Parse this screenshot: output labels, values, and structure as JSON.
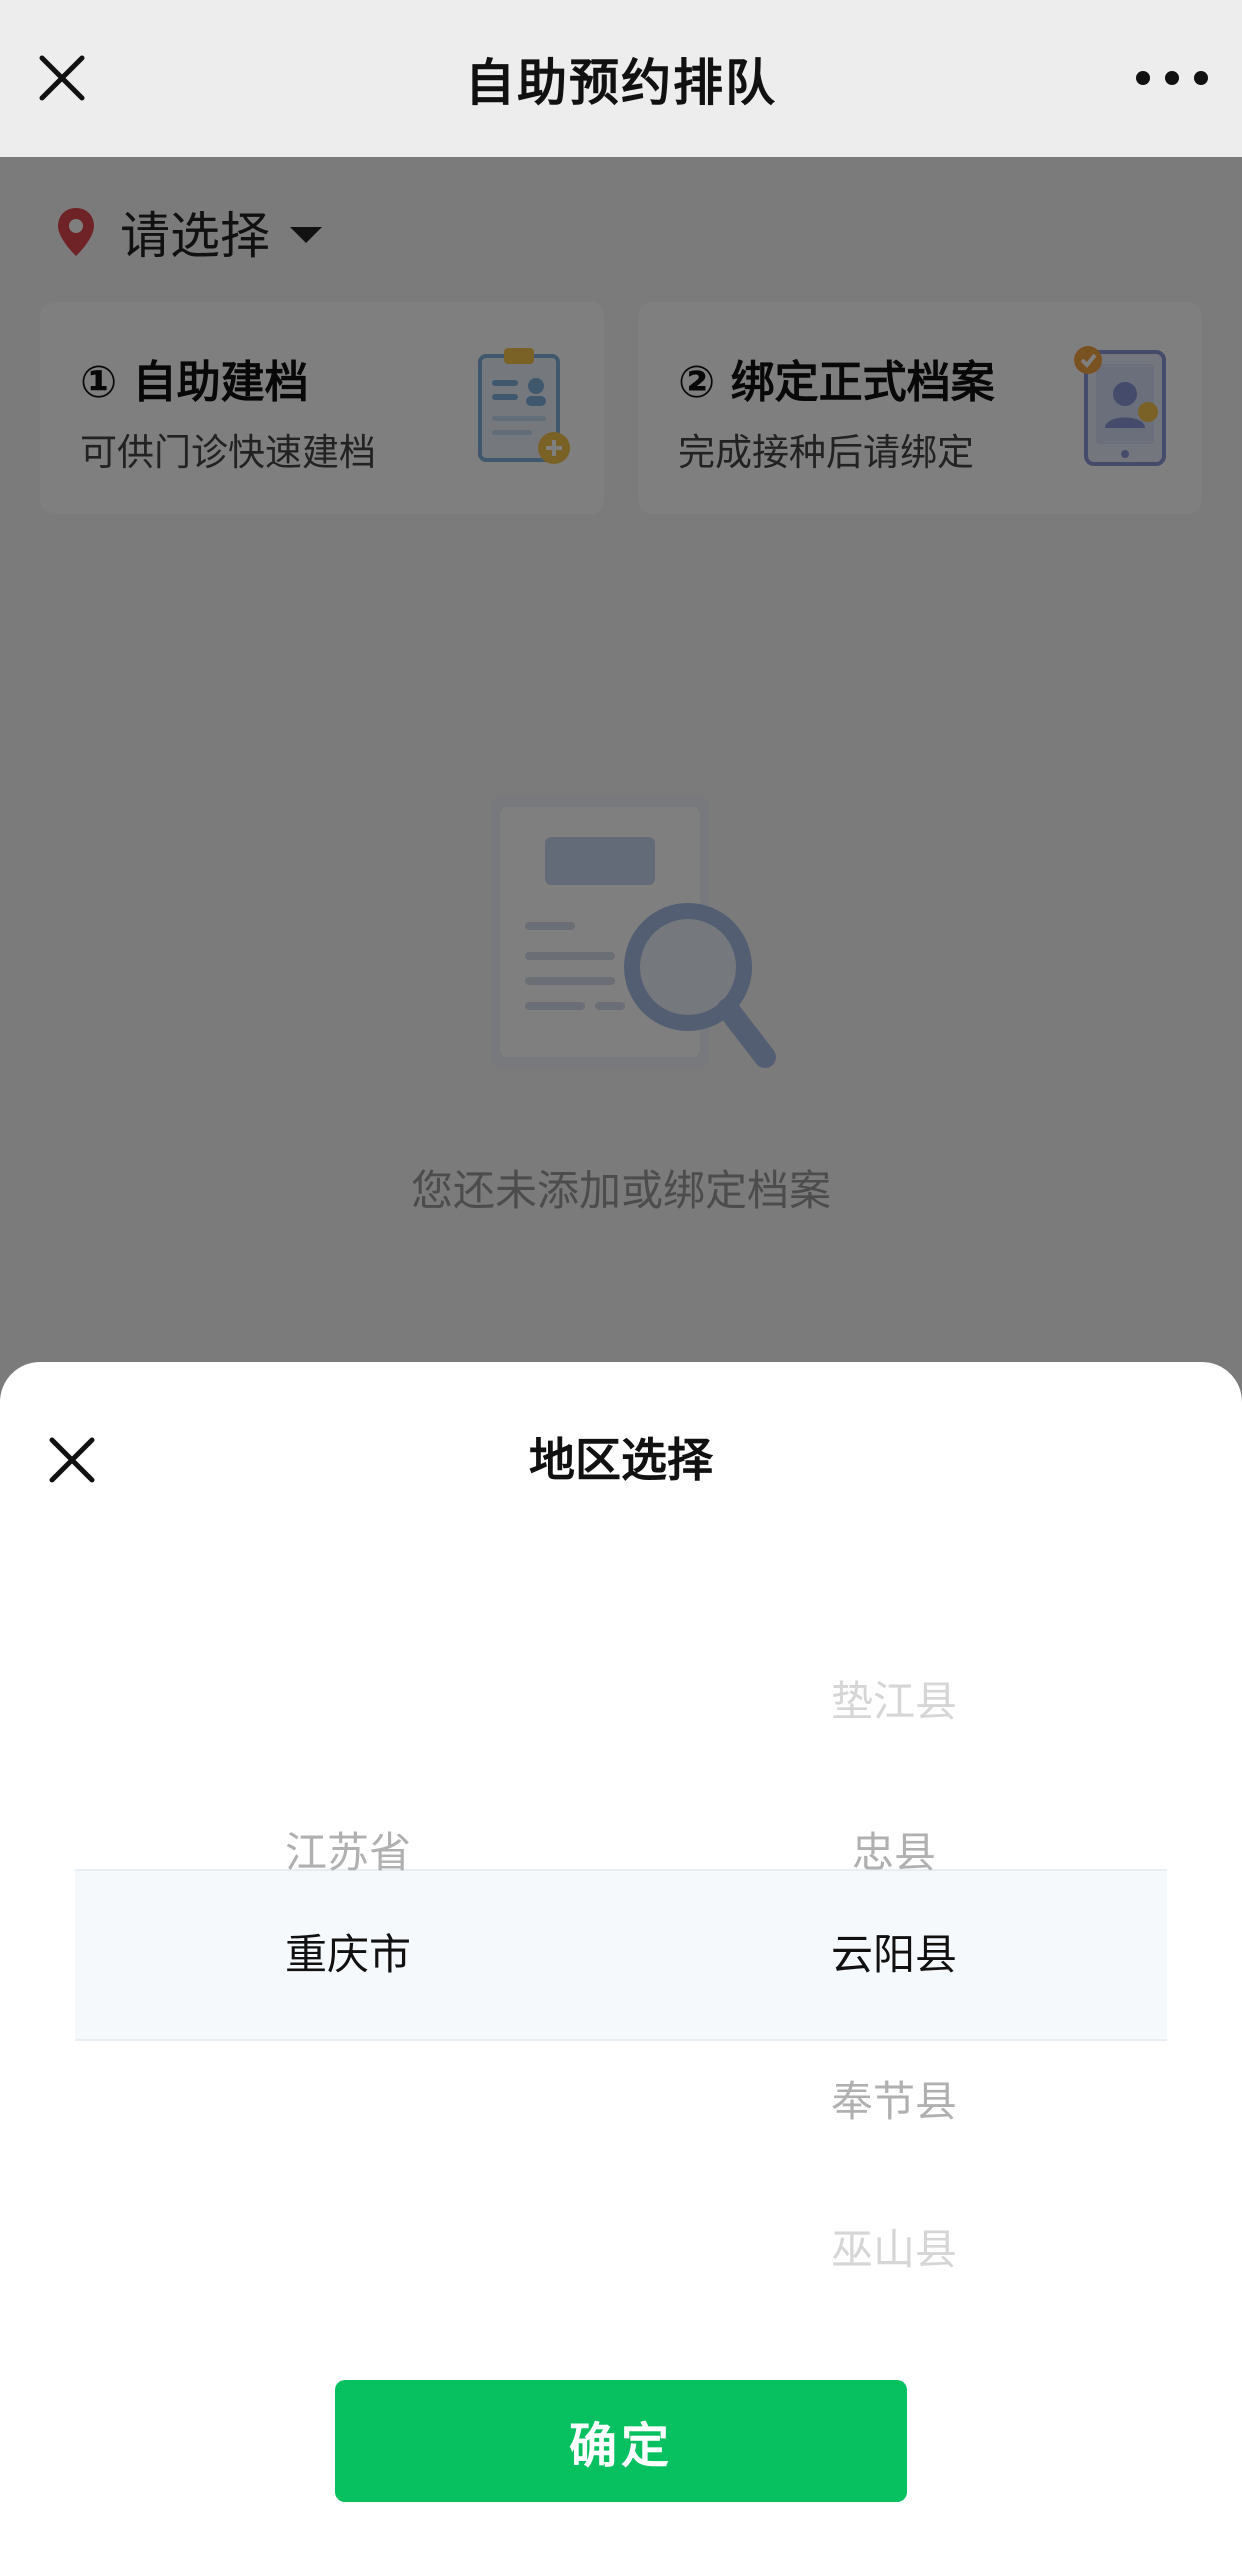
{
  "navbar": {
    "title": "自助预约排队",
    "close_icon": "close-icon",
    "more_icon": "more-icon"
  },
  "location": {
    "text": "请选择",
    "icon": "location-pin-icon",
    "pin_color": "#e0474c"
  },
  "cards": [
    {
      "title": "① 自助建档",
      "subtitle": "可供门诊快速建档",
      "icon": "clipboard-add-icon"
    },
    {
      "title": "② 绑定正式档案",
      "subtitle": "完成接种后请绑定",
      "icon": "tablet-user-icon"
    }
  ],
  "empty_state": {
    "text": "您还未添加或绑定档案",
    "icon": "document-search-icon"
  },
  "sheet": {
    "title": "地区选择",
    "close_icon": "close-icon",
    "provinces": [
      "江苏省",
      "重庆市"
    ],
    "province_selected": "重庆市",
    "counties": [
      "垫江县",
      "忠县",
      "云阳县",
      "奉节县",
      "巫山县"
    ],
    "county_selected": "云阳县",
    "confirm_label": "确定"
  },
  "colors": {
    "accent": "#07c160",
    "mask": "rgba(0,0,0,0.5)"
  }
}
